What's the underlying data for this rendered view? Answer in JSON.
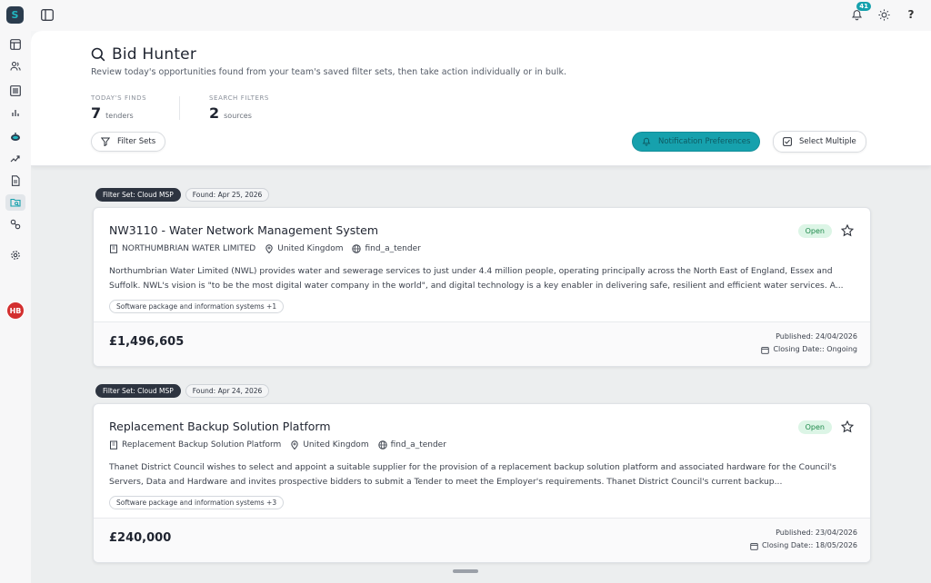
{
  "app": {
    "notifications_count": "41",
    "help_label": "?",
    "user_initials": "HB",
    "logo_glyph": "S",
    "accent_color": "#16a1ad"
  },
  "page": {
    "title": "Bid Hunter",
    "subtitle": "Review today's opportunities found from your team's saved filter sets, then take action individually or in bulk."
  },
  "stats": [
    {
      "label": "TODAY'S FINDS",
      "value": "7",
      "unit": "tenders"
    },
    {
      "label": "SEARCH FILTERS",
      "value": "2",
      "unit": "sources"
    }
  ],
  "toolbar": {
    "filter_sets_label": "Filter Sets",
    "notification_prefs_label": "Notification Preferences",
    "select_multiple_label": "Select Multiple"
  },
  "tenders": [
    {
      "filter_set": "Filter Set: Cloud MSP",
      "found": "Found: Apr 25, 2026",
      "title": "NW3110 - Water Network Management System",
      "status": "Open",
      "buyer": "NORTHUMBRIAN WATER LIMITED",
      "location": "United Kingdom",
      "source": "find_a_tender",
      "description": "Northumbrian Water Limited (NWL) provides water and sewerage services to just under 4.4 million people, operating principally across the North East of England, Essex and Suffolk. NWL's vision is \"to be the most digital water company in the world\", and digital technology is a key enabler in delivering safe, resilient and efficient water services. A...",
      "tag": "Software package and information systems +1",
      "value": "£1,496,605",
      "published": "Published: 24/04/2026",
      "closing": "Closing Date:: Ongoing"
    },
    {
      "filter_set": "Filter Set: Cloud MSP",
      "found": "Found: Apr 24, 2026",
      "title": "Replacement Backup Solution Platform",
      "status": "Open",
      "buyer": "Replacement Backup Solution Platform",
      "location": "United Kingdom",
      "source": "find_a_tender",
      "description": "Thanet District Council wishes to select and appoint a suitable supplier for the provision of a replacement backup solution platform and associated hardware for the Council's Servers, Data and Hardware and invites prospective bidders to submit a Tender to meet the Employer's requirements. Thanet District Council's current backup...",
      "tag": "Software package and information systems +3",
      "value": "£240,000",
      "published": "Published: 23/04/2026",
      "closing": "Closing Date:: 18/05/2026"
    }
  ]
}
